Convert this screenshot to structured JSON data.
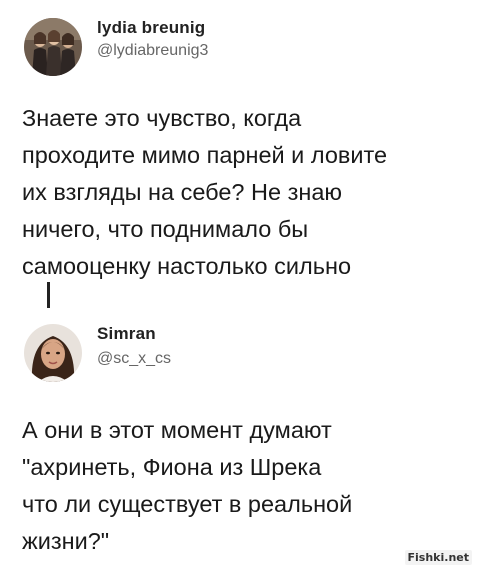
{
  "tweets": [
    {
      "name": "lydia breunig",
      "handle": "@lydiabreunig3",
      "text": "Знаете это чувство, когда\nпроходите мимо парней и ловите\nих взгляды на себе? Не знаю\nничего, что поднимало бы\nсамооценку настолько сильно"
    },
    {
      "name": "Simran",
      "handle": "@sc_x_cs",
      "text": "А они в этот момент думают\n\"ахринеть, Фиона из Шрека\nчто ли существует в реальной\nжизни?\""
    }
  ],
  "watermark": "Fishki.net",
  "colors": {
    "text": "#1a1a1a",
    "handle": "#666666",
    "background": "#ffffff"
  }
}
